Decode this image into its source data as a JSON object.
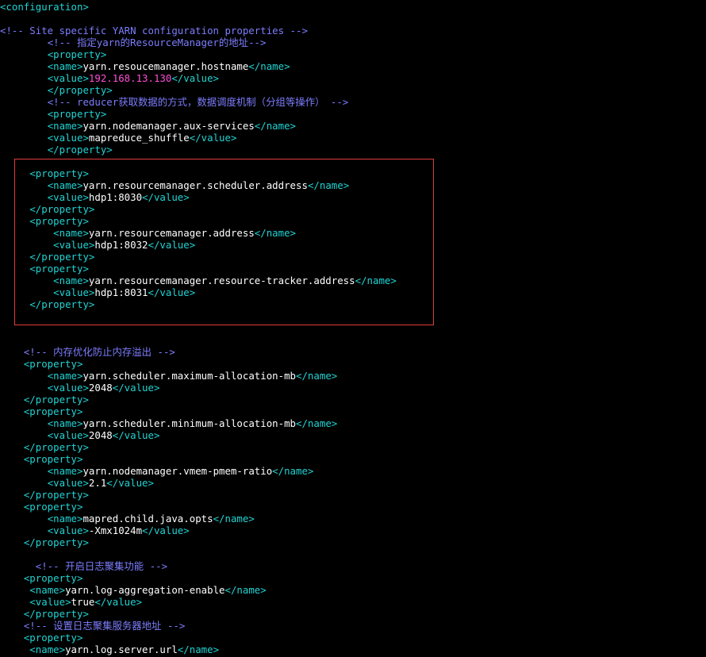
{
  "highlight_color": "#e03c3c",
  "colors": {
    "tag": "#21d3d3",
    "text": "#ffffff",
    "comment": "#7d7dff",
    "ip": "#ff4fd8",
    "background": "#000000"
  },
  "lines": [
    {
      "indent": "",
      "parts": [
        {
          "t": "tag",
          "v": "<configuration>"
        }
      ]
    },
    {
      "indent": "",
      "parts": []
    },
    {
      "indent": "",
      "parts": [
        {
          "t": "cmt",
          "v": "<!-- Site specific YARN configuration properties -->"
        }
      ]
    },
    {
      "indent": "        ",
      "parts": [
        {
          "t": "cmt",
          "v": "<!-- 指定yarn的ResourceManager的地址-->"
        }
      ]
    },
    {
      "indent": "        ",
      "parts": [
        {
          "t": "tag",
          "v": "<property>"
        }
      ]
    },
    {
      "indent": "        ",
      "parts": [
        {
          "t": "tag",
          "v": "<name>"
        },
        {
          "t": "txt",
          "v": "yarn.resoucemanager.hostname"
        },
        {
          "t": "tag",
          "v": "</name>"
        }
      ]
    },
    {
      "indent": "        ",
      "parts": [
        {
          "t": "tag",
          "v": "<value>"
        },
        {
          "t": "ip",
          "v": "192.168.13.130"
        },
        {
          "t": "tag",
          "v": "</value>"
        }
      ]
    },
    {
      "indent": "        ",
      "parts": [
        {
          "t": "tag",
          "v": "</property>"
        }
      ]
    },
    {
      "indent": "        ",
      "parts": [
        {
          "t": "cmt",
          "v": "<!-- reducer获取数据的方式，数据调度机制（分组等操作） -->"
        }
      ]
    },
    {
      "indent": "        ",
      "parts": [
        {
          "t": "tag",
          "v": "<property>"
        }
      ]
    },
    {
      "indent": "        ",
      "parts": [
        {
          "t": "tag",
          "v": "<name>"
        },
        {
          "t": "txt",
          "v": "yarn.nodemanager.aux-services"
        },
        {
          "t": "tag",
          "v": "</name>"
        }
      ]
    },
    {
      "indent": "        ",
      "parts": [
        {
          "t": "tag",
          "v": "<value>"
        },
        {
          "t": "txt",
          "v": "mapreduce_shuffle"
        },
        {
          "t": "tag",
          "v": "</value>"
        }
      ]
    },
    {
      "indent": "        ",
      "parts": [
        {
          "t": "tag",
          "v": "</property>"
        }
      ]
    },
    {
      "indent": "",
      "parts": []
    },
    {
      "indent": "     ",
      "parts": [
        {
          "t": "tag",
          "v": "<property>"
        }
      ]
    },
    {
      "indent": "        ",
      "parts": [
        {
          "t": "tag",
          "v": "<name>"
        },
        {
          "t": "txt",
          "v": "yarn.resourcemanager.scheduler.address"
        },
        {
          "t": "tag",
          "v": "</name>"
        }
      ]
    },
    {
      "indent": "        ",
      "parts": [
        {
          "t": "tag",
          "v": "<value>"
        },
        {
          "t": "txt",
          "v": "hdp1:8030"
        },
        {
          "t": "tag",
          "v": "</value>"
        }
      ]
    },
    {
      "indent": "     ",
      "parts": [
        {
          "t": "tag",
          "v": "</property>"
        }
      ]
    },
    {
      "indent": "     ",
      "parts": [
        {
          "t": "tag",
          "v": "<property>"
        }
      ]
    },
    {
      "indent": "         ",
      "parts": [
        {
          "t": "tag",
          "v": "<name>"
        },
        {
          "t": "txt",
          "v": "yarn.resourcemanager.address"
        },
        {
          "t": "tag",
          "v": "</name>"
        }
      ]
    },
    {
      "indent": "         ",
      "parts": [
        {
          "t": "tag",
          "v": "<value>"
        },
        {
          "t": "txt",
          "v": "hdp1:8032"
        },
        {
          "t": "tag",
          "v": "</value>"
        }
      ]
    },
    {
      "indent": "     ",
      "parts": [
        {
          "t": "tag",
          "v": "</property>"
        }
      ]
    },
    {
      "indent": "     ",
      "parts": [
        {
          "t": "tag",
          "v": "<property>"
        }
      ]
    },
    {
      "indent": "         ",
      "parts": [
        {
          "t": "tag",
          "v": "<name>"
        },
        {
          "t": "txt",
          "v": "yarn.resourcemanager.resource-tracker.address"
        },
        {
          "t": "tag",
          "v": "</name>"
        }
      ]
    },
    {
      "indent": "         ",
      "parts": [
        {
          "t": "tag",
          "v": "<value>"
        },
        {
          "t": "txt",
          "v": "hdp1:8031"
        },
        {
          "t": "tag",
          "v": "</value>"
        }
      ]
    },
    {
      "indent": "     ",
      "parts": [
        {
          "t": "tag",
          "v": "</property>"
        }
      ]
    },
    {
      "indent": "",
      "parts": []
    },
    {
      "indent": "",
      "parts": []
    },
    {
      "indent": "",
      "parts": []
    },
    {
      "indent": "    ",
      "parts": [
        {
          "t": "cmt",
          "v": "<!-- 内存优化防止内存溢出 -->"
        }
      ]
    },
    {
      "indent": "    ",
      "parts": [
        {
          "t": "tag",
          "v": "<property>"
        }
      ]
    },
    {
      "indent": "        ",
      "parts": [
        {
          "t": "tag",
          "v": "<name>"
        },
        {
          "t": "txt",
          "v": "yarn.scheduler.maximum-allocation-mb"
        },
        {
          "t": "tag",
          "v": "</name>"
        }
      ]
    },
    {
      "indent": "        ",
      "parts": [
        {
          "t": "tag",
          "v": "<value>"
        },
        {
          "t": "txt",
          "v": "2048"
        },
        {
          "t": "tag",
          "v": "</value>"
        }
      ]
    },
    {
      "indent": "    ",
      "parts": [
        {
          "t": "tag",
          "v": "</property>"
        }
      ]
    },
    {
      "indent": "    ",
      "parts": [
        {
          "t": "tag",
          "v": "<property>"
        }
      ]
    },
    {
      "indent": "        ",
      "parts": [
        {
          "t": "tag",
          "v": "<name>"
        },
        {
          "t": "txt",
          "v": "yarn.scheduler.minimum-allocation-mb"
        },
        {
          "t": "tag",
          "v": "</name>"
        }
      ]
    },
    {
      "indent": "        ",
      "parts": [
        {
          "t": "tag",
          "v": "<value>"
        },
        {
          "t": "txt",
          "v": "2048"
        },
        {
          "t": "tag",
          "v": "</value>"
        }
      ]
    },
    {
      "indent": "    ",
      "parts": [
        {
          "t": "tag",
          "v": "</property>"
        }
      ]
    },
    {
      "indent": "    ",
      "parts": [
        {
          "t": "tag",
          "v": "<property>"
        }
      ]
    },
    {
      "indent": "        ",
      "parts": [
        {
          "t": "tag",
          "v": "<name>"
        },
        {
          "t": "txt",
          "v": "yarn.nodemanager.vmem-pmem-ratio"
        },
        {
          "t": "tag",
          "v": "</name>"
        }
      ]
    },
    {
      "indent": "        ",
      "parts": [
        {
          "t": "tag",
          "v": "<value>"
        },
        {
          "t": "txt",
          "v": "2.1"
        },
        {
          "t": "tag",
          "v": "</value>"
        }
      ]
    },
    {
      "indent": "    ",
      "parts": [
        {
          "t": "tag",
          "v": "</property>"
        }
      ]
    },
    {
      "indent": "    ",
      "parts": [
        {
          "t": "tag",
          "v": "<property>"
        }
      ]
    },
    {
      "indent": "        ",
      "parts": [
        {
          "t": "tag",
          "v": "<name>"
        },
        {
          "t": "txt",
          "v": "mapred.child.java.opts"
        },
        {
          "t": "tag",
          "v": "</name>"
        }
      ]
    },
    {
      "indent": "        ",
      "parts": [
        {
          "t": "tag",
          "v": "<value>"
        },
        {
          "t": "txt",
          "v": "-Xmx1024m"
        },
        {
          "t": "tag",
          "v": "</value>"
        }
      ]
    },
    {
      "indent": "    ",
      "parts": [
        {
          "t": "tag",
          "v": "</property>"
        }
      ]
    },
    {
      "indent": "",
      "parts": []
    },
    {
      "indent": "      ",
      "parts": [
        {
          "t": "cmt",
          "v": "<!-- 开启日志聚集功能 -->"
        }
      ]
    },
    {
      "indent": "    ",
      "parts": [
        {
          "t": "tag",
          "v": "<property>"
        }
      ]
    },
    {
      "indent": "     ",
      "parts": [
        {
          "t": "tag",
          "v": "<name>"
        },
        {
          "t": "txt",
          "v": "yarn.log-aggregation-enable"
        },
        {
          "t": "tag",
          "v": "</name>"
        }
      ]
    },
    {
      "indent": "     ",
      "parts": [
        {
          "t": "tag",
          "v": "<value>"
        },
        {
          "t": "txt",
          "v": "true"
        },
        {
          "t": "tag",
          "v": "</value>"
        }
      ]
    },
    {
      "indent": "    ",
      "parts": [
        {
          "t": "tag",
          "v": "</property>"
        }
      ]
    },
    {
      "indent": "    ",
      "parts": [
        {
          "t": "cmt",
          "v": "<!-- 设置日志聚集服务器地址 -->"
        }
      ]
    },
    {
      "indent": "    ",
      "parts": [
        {
          "t": "tag",
          "v": "<property>"
        }
      ]
    },
    {
      "indent": "     ",
      "parts": [
        {
          "t": "tag",
          "v": "<name>"
        },
        {
          "t": "txt",
          "v": "yarn.log.server.url"
        },
        {
          "t": "tag",
          "v": "</name>"
        }
      ]
    }
  ]
}
